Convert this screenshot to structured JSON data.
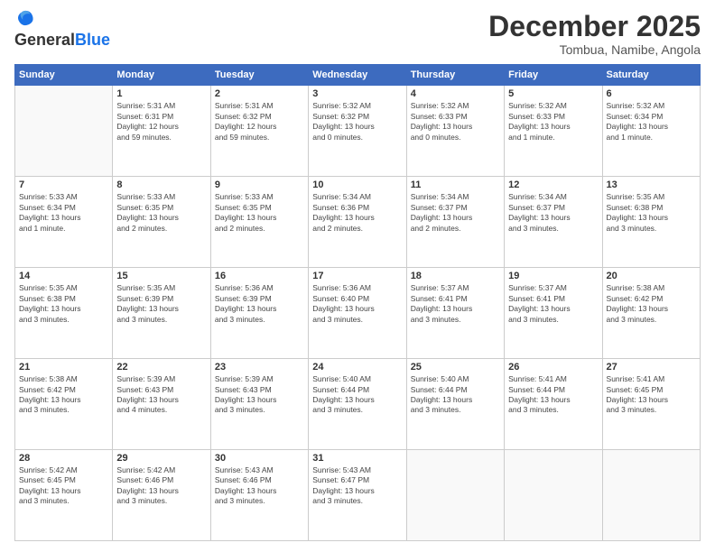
{
  "header": {
    "logo_general": "General",
    "logo_blue": "Blue",
    "month_title": "December 2025",
    "subtitle": "Tombua, Namibe, Angola"
  },
  "days_of_week": [
    "Sunday",
    "Monday",
    "Tuesday",
    "Wednesday",
    "Thursday",
    "Friday",
    "Saturday"
  ],
  "weeks": [
    [
      {
        "day": "",
        "info": ""
      },
      {
        "day": "1",
        "info": "Sunrise: 5:31 AM\nSunset: 6:31 PM\nDaylight: 12 hours\nand 59 minutes."
      },
      {
        "day": "2",
        "info": "Sunrise: 5:31 AM\nSunset: 6:32 PM\nDaylight: 12 hours\nand 59 minutes."
      },
      {
        "day": "3",
        "info": "Sunrise: 5:32 AM\nSunset: 6:32 PM\nDaylight: 13 hours\nand 0 minutes."
      },
      {
        "day": "4",
        "info": "Sunrise: 5:32 AM\nSunset: 6:33 PM\nDaylight: 13 hours\nand 0 minutes."
      },
      {
        "day": "5",
        "info": "Sunrise: 5:32 AM\nSunset: 6:33 PM\nDaylight: 13 hours\nand 1 minute."
      },
      {
        "day": "6",
        "info": "Sunrise: 5:32 AM\nSunset: 6:34 PM\nDaylight: 13 hours\nand 1 minute."
      }
    ],
    [
      {
        "day": "7",
        "info": "Sunrise: 5:33 AM\nSunset: 6:34 PM\nDaylight: 13 hours\nand 1 minute."
      },
      {
        "day": "8",
        "info": "Sunrise: 5:33 AM\nSunset: 6:35 PM\nDaylight: 13 hours\nand 2 minutes."
      },
      {
        "day": "9",
        "info": "Sunrise: 5:33 AM\nSunset: 6:35 PM\nDaylight: 13 hours\nand 2 minutes."
      },
      {
        "day": "10",
        "info": "Sunrise: 5:34 AM\nSunset: 6:36 PM\nDaylight: 13 hours\nand 2 minutes."
      },
      {
        "day": "11",
        "info": "Sunrise: 5:34 AM\nSunset: 6:37 PM\nDaylight: 13 hours\nand 2 minutes."
      },
      {
        "day": "12",
        "info": "Sunrise: 5:34 AM\nSunset: 6:37 PM\nDaylight: 13 hours\nand 3 minutes."
      },
      {
        "day": "13",
        "info": "Sunrise: 5:35 AM\nSunset: 6:38 PM\nDaylight: 13 hours\nand 3 minutes."
      }
    ],
    [
      {
        "day": "14",
        "info": "Sunrise: 5:35 AM\nSunset: 6:38 PM\nDaylight: 13 hours\nand 3 minutes."
      },
      {
        "day": "15",
        "info": "Sunrise: 5:35 AM\nSunset: 6:39 PM\nDaylight: 13 hours\nand 3 minutes."
      },
      {
        "day": "16",
        "info": "Sunrise: 5:36 AM\nSunset: 6:39 PM\nDaylight: 13 hours\nand 3 minutes."
      },
      {
        "day": "17",
        "info": "Sunrise: 5:36 AM\nSunset: 6:40 PM\nDaylight: 13 hours\nand 3 minutes."
      },
      {
        "day": "18",
        "info": "Sunrise: 5:37 AM\nSunset: 6:41 PM\nDaylight: 13 hours\nand 3 minutes."
      },
      {
        "day": "19",
        "info": "Sunrise: 5:37 AM\nSunset: 6:41 PM\nDaylight: 13 hours\nand 3 minutes."
      },
      {
        "day": "20",
        "info": "Sunrise: 5:38 AM\nSunset: 6:42 PM\nDaylight: 13 hours\nand 3 minutes."
      }
    ],
    [
      {
        "day": "21",
        "info": "Sunrise: 5:38 AM\nSunset: 6:42 PM\nDaylight: 13 hours\nand 3 minutes."
      },
      {
        "day": "22",
        "info": "Sunrise: 5:39 AM\nSunset: 6:43 PM\nDaylight: 13 hours\nand 4 minutes."
      },
      {
        "day": "23",
        "info": "Sunrise: 5:39 AM\nSunset: 6:43 PM\nDaylight: 13 hours\nand 3 minutes."
      },
      {
        "day": "24",
        "info": "Sunrise: 5:40 AM\nSunset: 6:44 PM\nDaylight: 13 hours\nand 3 minutes."
      },
      {
        "day": "25",
        "info": "Sunrise: 5:40 AM\nSunset: 6:44 PM\nDaylight: 13 hours\nand 3 minutes."
      },
      {
        "day": "26",
        "info": "Sunrise: 5:41 AM\nSunset: 6:44 PM\nDaylight: 13 hours\nand 3 minutes."
      },
      {
        "day": "27",
        "info": "Sunrise: 5:41 AM\nSunset: 6:45 PM\nDaylight: 13 hours\nand 3 minutes."
      }
    ],
    [
      {
        "day": "28",
        "info": "Sunrise: 5:42 AM\nSunset: 6:45 PM\nDaylight: 13 hours\nand 3 minutes."
      },
      {
        "day": "29",
        "info": "Sunrise: 5:42 AM\nSunset: 6:46 PM\nDaylight: 13 hours\nand 3 minutes."
      },
      {
        "day": "30",
        "info": "Sunrise: 5:43 AM\nSunset: 6:46 PM\nDaylight: 13 hours\nand 3 minutes."
      },
      {
        "day": "31",
        "info": "Sunrise: 5:43 AM\nSunset: 6:47 PM\nDaylight: 13 hours\nand 3 minutes."
      },
      {
        "day": "",
        "info": ""
      },
      {
        "day": "",
        "info": ""
      },
      {
        "day": "",
        "info": ""
      }
    ]
  ]
}
